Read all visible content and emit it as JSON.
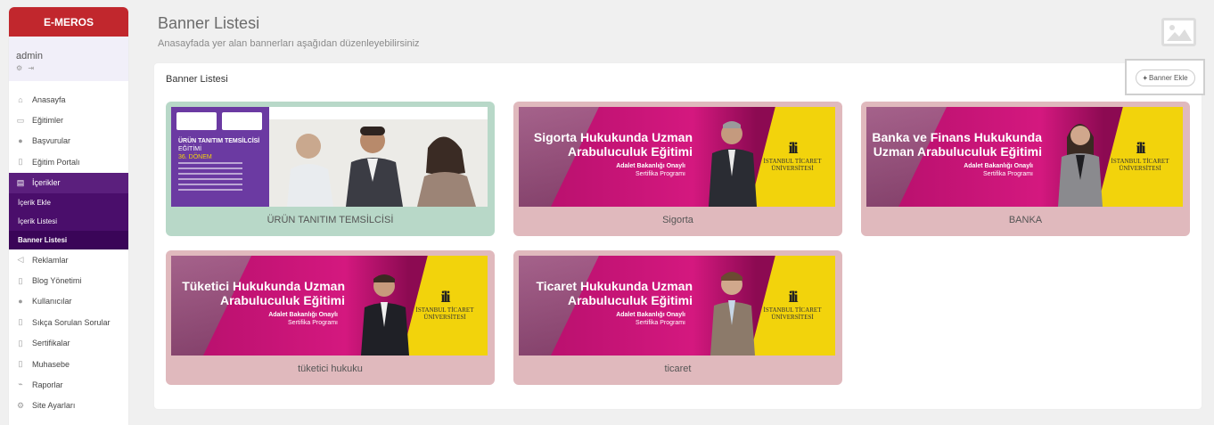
{
  "sidebar": {
    "brand": "E-MEROS",
    "user": {
      "name": "admin"
    },
    "menu": [
      {
        "label": "Anasayfa",
        "icon": "home-icon"
      },
      {
        "label": "Eğitimler",
        "icon": "book-icon"
      },
      {
        "label": "Başvurular",
        "icon": "users-icon"
      },
      {
        "label": "Eğitim Portalı",
        "icon": "file-icon"
      }
    ],
    "active_item": {
      "label": "İçerikler",
      "icon": "file-text-icon"
    },
    "submenu": [
      {
        "label": "İçerik Ekle"
      },
      {
        "label": "İçerik Listesi"
      },
      {
        "label": "Banner Listesi"
      }
    ],
    "menu2": [
      {
        "label": "Reklamlar",
        "icon": "megaphone-icon"
      },
      {
        "label": "Blog Yönetimi",
        "icon": "file-icon"
      },
      {
        "label": "Kullanıcılar",
        "icon": "users-icon"
      },
      {
        "label": "Sıkça Sorulan Sorular",
        "icon": "file-icon"
      },
      {
        "label": "Sertifikalar",
        "icon": "file-icon"
      },
      {
        "label": "Muhasebe",
        "icon": "file-icon"
      },
      {
        "label": "Raporlar",
        "icon": "chart-icon"
      },
      {
        "label": "Site Ayarları",
        "icon": "gear-icon"
      }
    ]
  },
  "header": {
    "title": "Banner Listesi",
    "subtitle": "Anasayfada yer alan bannerları aşağıdan düzenleyebilirsiniz"
  },
  "panel": {
    "title": "Banner Listesi",
    "add_button": "Banner Ekle"
  },
  "banners": [
    {
      "caption": "ÜRÜN TANITIM TEMSİLCİSİ",
      "bg": "#b8d8c8",
      "art": {
        "title": "ÜRÜN TANITIM TEMSİLCİSİ",
        "line2": "EĞİTİMİ",
        "line3": "36. DÖNEM"
      }
    },
    {
      "caption": "Sigorta",
      "bg": "#e0b9bd",
      "art": {
        "title1": "Sigorta Hukukunda Uzman",
        "title2": "Arabuluculuk Eğitimi",
        "sub1": "Adalet Bakanlığı Onaylı",
        "sub2": "Sertifika Programı",
        "logo_mark": "ili",
        "logo_name1": "İSTANBUL TİCARET",
        "logo_name2": "ÜNİVERSİTESİ"
      }
    },
    {
      "caption": "BANKA",
      "bg": "#e0b9bd",
      "art": {
        "title1": "Banka ve Finans Hukukunda",
        "title2": "Uzman Arabuluculuk Eğitimi",
        "sub1": "Adalet Bakanlığı Onaylı",
        "sub2": "Sertifika Programı",
        "logo_mark": "ili",
        "logo_name1": "İSTANBUL TİCARET",
        "logo_name2": "ÜNİVERSİTESİ"
      }
    },
    {
      "caption": "tüketici hukuku",
      "bg": "#e0b9bd",
      "art": {
        "title1": "Tüketici Hukukunda Uzman",
        "title2": "Arabuluculuk Eğitimi",
        "sub1": "Adalet Bakanlığı Onaylı",
        "sub2": "Sertifika Programı",
        "logo_mark": "ili",
        "logo_name1": "İSTANBUL TİCARET",
        "logo_name2": "ÜNİVERSİTESİ"
      }
    },
    {
      "caption": "ticaret",
      "bg": "#e0b9bd",
      "art": {
        "title1": "Ticaret Hukukunda Uzman",
        "title2": "Arabuluculuk Eğitimi",
        "sub1": "Adalet Bakanlığı Onaylı",
        "sub2": "Sertifika Programı",
        "logo_mark": "ili",
        "logo_name1": "İSTANBUL TİCARET",
        "logo_name2": "ÜNİVERSİTESİ"
      }
    }
  ]
}
